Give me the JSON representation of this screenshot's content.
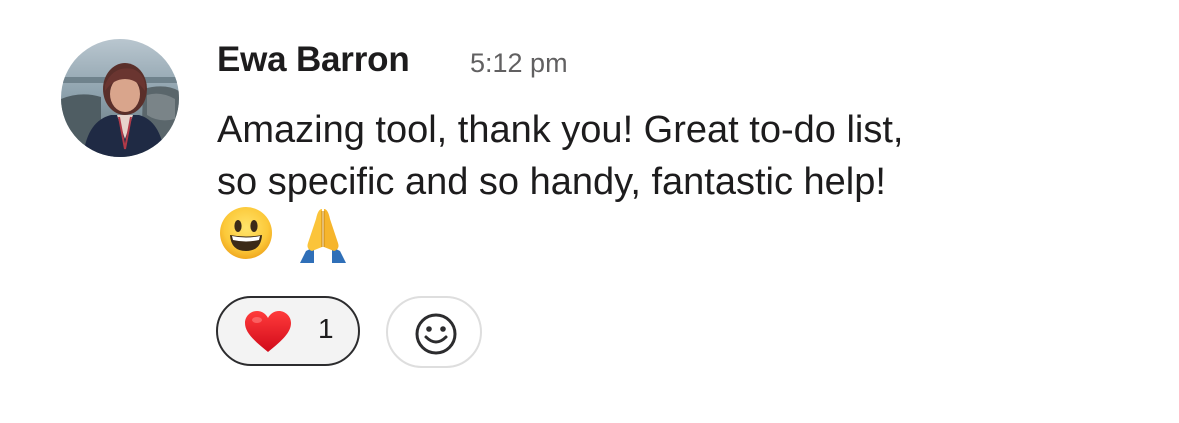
{
  "message": {
    "author": "Ewa Barron",
    "timestamp": "5:12 pm",
    "lines": [
      "Amazing tool, thank you! Great to-do list,",
      "so specific and so handy, fantastic help!"
    ],
    "emojis": [
      "grinning-face",
      "folded-hands"
    ]
  },
  "reactions": [
    {
      "emoji": "red-heart",
      "count": "1"
    }
  ],
  "add_reaction": {
    "icon": "add-reaction-smiley-icon"
  },
  "colors": {
    "text": "#1d1c1d",
    "timestamp": "#616061",
    "reaction_border": "#2c2c2e",
    "reaction_bg": "#f3f3f3",
    "add_reaction_border": "#dedede"
  }
}
